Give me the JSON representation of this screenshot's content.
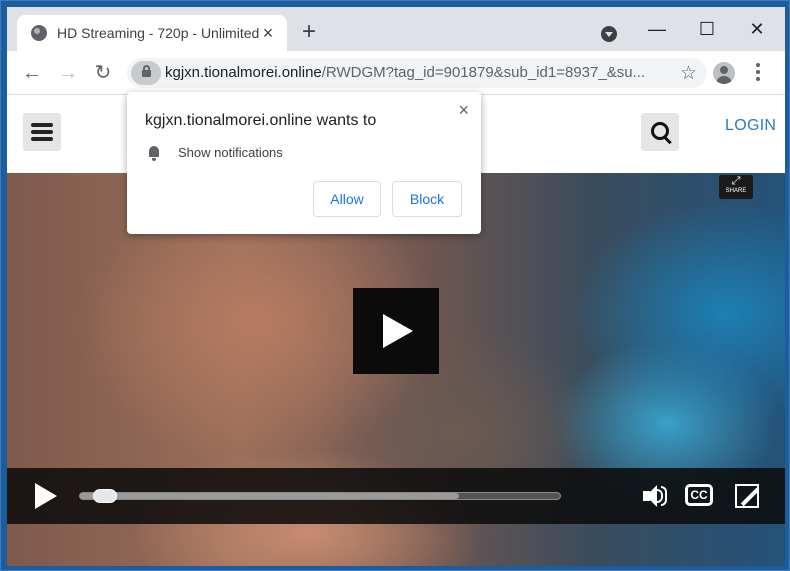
{
  "browser": {
    "tab_title": "HD Streaming - 720p - Unlimited",
    "new_tab_icon": "+",
    "url_host": "kgjxn.tionalmorei.online",
    "url_path": "/RWDGM?tag_id=901879&sub_id1=8937_&su...",
    "window_controls": {
      "minimize": "—",
      "maximize": "☐",
      "close": "✕"
    }
  },
  "site": {
    "login_label": "LOGIN",
    "share_label": "SHARE"
  },
  "player": {
    "cc_label": "CC",
    "progress_fraction": 0.03,
    "buffered_fraction": 0.79
  },
  "popup": {
    "heading": "kgjxn.tionalmorei.online wants to",
    "permission": "Show notifications",
    "allow_label": "Allow",
    "block_label": "Block",
    "close_icon": "×"
  }
}
